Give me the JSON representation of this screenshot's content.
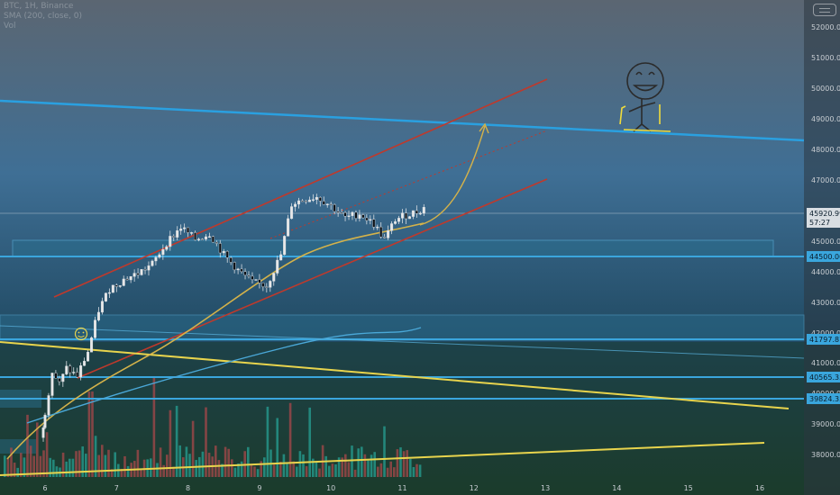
{
  "legend": {
    "line1": "BTC, 1H, Binance",
    "line2": "SMA (200, close, 0)",
    "line3": "Vol"
  },
  "colors": {
    "channel": "#c0392b",
    "trendline_blue": "#2aa0e0",
    "support_blue": "#3aa6dd",
    "yellow": "#e8d44d",
    "sma": "#d4b24a",
    "sma_long": "#4aa8d8",
    "candle_up": "#e8e8e8",
    "candle_down": "#0b0f14",
    "vol_up": "#26a69a",
    "vol_down": "#b0484b",
    "zone": "#2a6f8f",
    "smiley": "#e8d44d"
  },
  "chart_data": {
    "type": "candlestick",
    "x_ticks": [
      "6",
      "7",
      "8",
      "9",
      "10",
      "11",
      "12",
      "13",
      "14",
      "15",
      "16"
    ],
    "y_ticks": [
      "38000.00",
      "39000.00",
      "40000.00",
      "41000.00",
      "42000.00",
      "43000.00",
      "44000.00",
      "45000.00",
      "47000.00",
      "48000.00",
      "49000.00",
      "50000.00",
      "51000.00",
      "52000.00"
    ],
    "ylim": [
      37500,
      52500
    ],
    "price_tag": {
      "value": "45920.99",
      "countdown": "57:27"
    },
    "level_tags": [
      "44500.00",
      "41797.87",
      "40565.35",
      "39824.35"
    ],
    "levels": [
      44500,
      41797.87,
      40565.35,
      39824.35
    ],
    "zones": [
      [
        44500,
        44950
      ],
      [
        41800,
        42600
      ]
    ],
    "last_price": 45920.99,
    "candles_ohlc_anchor": [
      [
        5.95,
        38450
      ],
      [
        6.0,
        39300
      ],
      [
        6.1,
        40600
      ],
      [
        6.2,
        40200
      ],
      [
        6.3,
        40700
      ],
      [
        6.45,
        40450
      ],
      [
        6.6,
        41250
      ],
      [
        6.75,
        42600
      ],
      [
        6.9,
        43300
      ],
      [
        7.1,
        43600
      ],
      [
        7.3,
        43800
      ],
      [
        7.5,
        44100
      ],
      [
        7.7,
        44800
      ],
      [
        7.9,
        45300
      ],
      [
        8.1,
        44900
      ],
      [
        8.3,
        45100
      ],
      [
        8.5,
        44400
      ],
      [
        8.7,
        43900
      ],
      [
        8.9,
        43500
      ],
      [
        9.1,
        43400
      ],
      [
        9.3,
        44400
      ],
      [
        9.45,
        46050
      ],
      [
        9.6,
        46200
      ],
      [
        9.8,
        46300
      ],
      [
        10.0,
        46000
      ],
      [
        10.2,
        45600
      ],
      [
        10.4,
        45750
      ],
      [
        10.6,
        45400
      ],
      [
        10.75,
        44900
      ],
      [
        10.9,
        45550
      ],
      [
        11.05,
        45700
      ],
      [
        11.2,
        45800
      ],
      [
        11.3,
        45920.99
      ]
    ]
  }
}
